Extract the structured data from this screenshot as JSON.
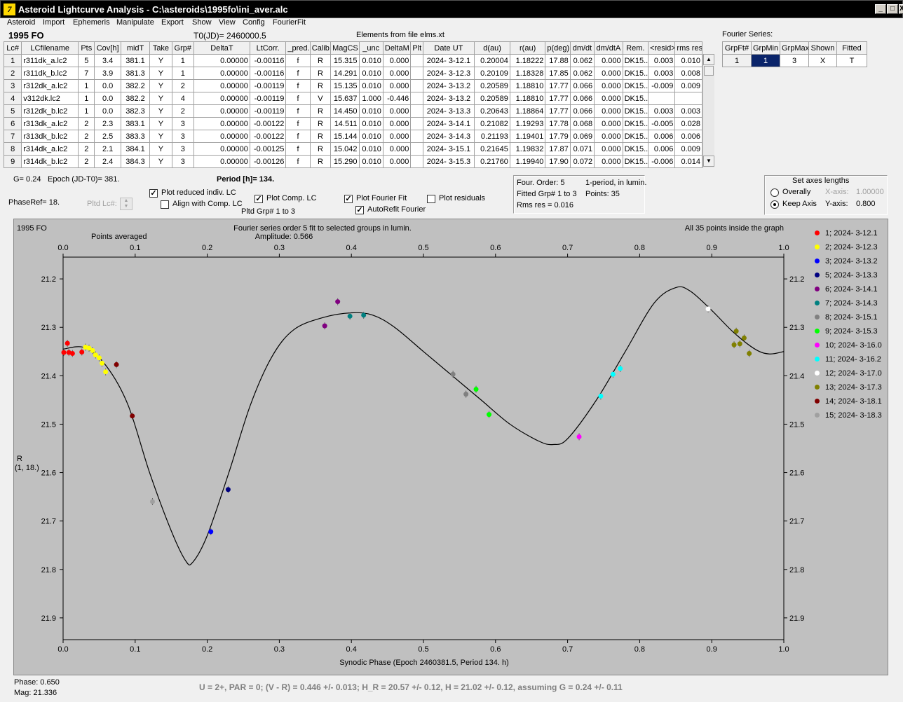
{
  "window": {
    "title": "Asteroid Lightcurve Analysis - C:\\asteroids\\1995fo\\ini_aver.alc",
    "min": "_",
    "max": "□",
    "close": "X"
  },
  "menu": [
    "Asteroid",
    "Import",
    "Ephemeris",
    "Manipulate",
    "Export",
    "Show",
    "View",
    "Config",
    "FourierFit"
  ],
  "header": {
    "object": "1995 FO",
    "t0": "T0(JD)= 2460000.5",
    "elements": "Elements from file elms.xt",
    "fourier_label": "Fourier Series:"
  },
  "table": {
    "columns": [
      "Lc#",
      "LCfilename",
      "Pts",
      "Cov[h]",
      "midT",
      "Take",
      "Grp#",
      "DeltaT",
      "LtCorr.",
      "_pred.",
      "Calib.",
      "MagCS",
      "_unc",
      "DeltaM",
      "Plt",
      "Date UT",
      "d(au)",
      "r(au)",
      "p(deg)",
      "dm/dt",
      "dm/dtA",
      "Rem.",
      "<resid>",
      "rms res"
    ],
    "rows": [
      [
        "1",
        "r311dk_a.lc2",
        "5",
        "3.4",
        "381.1",
        "Y",
        "1",
        "0.00000",
        "-0.00116",
        "f",
        "R",
        "15.315",
        "0.010",
        "0.000",
        "",
        "2024- 3-12.1",
        "0.20004",
        "1.18222",
        "17.88",
        "0.062",
        "0.000",
        "DK15..",
        "0.003",
        "0.010"
      ],
      [
        "2",
        "r311dk_b.lc2",
        "7",
        "3.9",
        "381.3",
        "Y",
        "1",
        "0.00000",
        "-0.00116",
        "f",
        "R",
        "14.291",
        "0.010",
        "0.000",
        "",
        "2024- 3-12.3",
        "0.20109",
        "1.18328",
        "17.85",
        "0.062",
        "0.000",
        "DK15..",
        "0.003",
        "0.008"
      ],
      [
        "3",
        "r312dk_a.lc2",
        "1",
        "0.0",
        "382.2",
        "Y",
        "2",
        "0.00000",
        "-0.00119",
        "f",
        "R",
        "15.135",
        "0.010",
        "0.000",
        "",
        "2024- 3-13.2",
        "0.20589",
        "1.18810",
        "17.77",
        "0.066",
        "0.000",
        "DK15..",
        "-0.009",
        "0.009"
      ],
      [
        "4",
        "v312dk.lc2",
        "1",
        "0.0",
        "382.2",
        "Y",
        "4",
        "0.00000",
        "-0.00119",
        "f",
        "V",
        "15.637",
        "1.000",
        "-0.446",
        "",
        "2024- 3-13.2",
        "0.20589",
        "1.18810",
        "17.77",
        "0.066",
        "0.000",
        "DK15..",
        "",
        ""
      ],
      [
        "5",
        "r312dk_b.lc2",
        "1",
        "0.0",
        "382.3",
        "Y",
        "2",
        "0.00000",
        "-0.00119",
        "f",
        "R",
        "14.450",
        "0.010",
        "0.000",
        "",
        "2024- 3-13.3",
        "0.20643",
        "1.18864",
        "17.77",
        "0.066",
        "0.000",
        "DK15..",
        "0.003",
        "0.003"
      ],
      [
        "6",
        "r313dk_a.lc2",
        "2",
        "2.3",
        "383.1",
        "Y",
        "3",
        "0.00000",
        "-0.00122",
        "f",
        "R",
        "14.511",
        "0.010",
        "0.000",
        "",
        "2024- 3-14.1",
        "0.21082",
        "1.19293",
        "17.78",
        "0.068",
        "0.000",
        "DK15..",
        "-0.005",
        "0.028"
      ],
      [
        "7",
        "r313dk_b.lc2",
        "2",
        "2.5",
        "383.3",
        "Y",
        "3",
        "0.00000",
        "-0.00122",
        "f",
        "R",
        "15.144",
        "0.010",
        "0.000",
        "",
        "2024- 3-14.3",
        "0.21193",
        "1.19401",
        "17.79",
        "0.069",
        "0.000",
        "DK15..",
        "0.006",
        "0.006"
      ],
      [
        "8",
        "r314dk_a.lc2",
        "2",
        "2.1",
        "384.1",
        "Y",
        "3",
        "0.00000",
        "-0.00125",
        "f",
        "R",
        "15.042",
        "0.010",
        "0.000",
        "",
        "2024- 3-15.1",
        "0.21645",
        "1.19832",
        "17.87",
        "0.071",
        "0.000",
        "DK15..",
        "0.006",
        "0.009"
      ],
      [
        "9",
        "r314dk_b.lc2",
        "2",
        "2.4",
        "384.3",
        "Y",
        "3",
        "0.00000",
        "-0.00126",
        "f",
        "R",
        "15.290",
        "0.010",
        "0.000",
        "",
        "2024- 3-15.3",
        "0.21760",
        "1.19940",
        "17.90",
        "0.072",
        "0.000",
        "DK15..",
        "-0.006",
        "0.014"
      ]
    ]
  },
  "fourier_table": {
    "columns": [
      "GrpFt#",
      "GrpMin",
      "GrpMax",
      "Shown",
      "Fitted"
    ],
    "row": [
      "1",
      "1",
      "3",
      "X",
      "T"
    ]
  },
  "info": {
    "g": "G= 0.24",
    "epoch": "Epoch (JD-T0)= 381.",
    "period": "Period [h]= 134.",
    "phaseref": "PhaseRef= 18.",
    "pltd_lc": "Pltd Lc#:",
    "pltd_grp": "Pltd Grp#  1   to   3"
  },
  "checks": {
    "plot_reduced": "Plot reduced indiv. LC",
    "align": "Align with Comp. LC",
    "plot_comp": "Plot Comp. LC",
    "plot_fourier": "Plot Fourier Fit",
    "autorefit": "AutoRefit Fourier",
    "plot_resid": "Plot residuals"
  },
  "fourier_info": {
    "order": "Four. Order:  5",
    "period_mode": "1-period, in lumin.",
    "fitted": "Fitted Grp# 1 to 3",
    "points": "Points: 35",
    "rms": "Rms res     = 0.016"
  },
  "axes_panel": {
    "title": "Set axes lengths",
    "overally": "Overally",
    "keep": "Keep Axis",
    "xaxis_label": "X-axis:",
    "xaxis_val": "1.00000",
    "yaxis_label": "Y-axis:",
    "yaxis_val": "0.800"
  },
  "status": {
    "phase": "Phase:  0.650",
    "mag": "Mag:    21.336",
    "formula": "U = 2+, PAR = 0; (V - R) = 0.446 +/- 0.013; H_R = 20.57 +/- 0.12, H = 21.02 +/- 0.12, assuming G = 0.24 +/- 0.11"
  },
  "chart_data": {
    "type": "scatter",
    "title": "1995 FO",
    "subtitle": "Fourier series order 5 fit to selected groups in lumin.",
    "subtitle2": "Amplitude: 0.566",
    "note_left": "Points averaged",
    "note_right": "All 35 points inside the graph",
    "xlabel": "Synodic Phase (Epoch 2460381.5, Period 134. h)",
    "ylabel": "R",
    "ylabel2": "(1, 18.)",
    "xlim": [
      0,
      1
    ],
    "ylim": [
      21.9,
      21.1
    ],
    "xticks": [
      "0.0",
      "0.1",
      "0.2",
      "0.3",
      "0.4",
      "0.5",
      "0.6",
      "0.7",
      "0.8",
      "0.9",
      "1.0"
    ],
    "yticks": [
      "21.2",
      "21.3",
      "21.4",
      "21.5",
      "21.6",
      "21.7",
      "21.8",
      "21.9"
    ],
    "series": [
      {
        "name": "1; 2024- 3-12.1",
        "color": "#ff0000",
        "points": [
          [
            0.001,
            21.352
          ],
          [
            0.006,
            21.333
          ],
          [
            0.008,
            21.352
          ],
          [
            0.013,
            21.354
          ],
          [
            0.026,
            21.351
          ]
        ]
      },
      {
        "name": "2; 2024- 3-12.3",
        "color": "#ffff00",
        "points": [
          [
            0.031,
            21.341
          ],
          [
            0.036,
            21.343
          ],
          [
            0.041,
            21.348
          ],
          [
            0.045,
            21.357
          ],
          [
            0.05,
            21.363
          ],
          [
            0.054,
            21.374
          ],
          [
            0.059,
            21.392
          ]
        ]
      },
      {
        "name": "3; 2024- 3-13.2",
        "color": "#0000ff",
        "points": [
          [
            0.205,
            21.722
          ]
        ]
      },
      {
        "name": "5; 2024- 3-13.3",
        "color": "#000080",
        "points": [
          [
            0.229,
            21.635
          ]
        ]
      },
      {
        "name": "6; 2024- 3-14.1",
        "color": "#800080",
        "points": [
          [
            0.363,
            21.297
          ],
          [
            0.381,
            21.247
          ]
        ]
      },
      {
        "name": "7; 2024- 3-14.3",
        "color": "#008080",
        "points": [
          [
            0.398,
            21.277
          ],
          [
            0.417,
            21.275
          ]
        ]
      },
      {
        "name": "8; 2024- 3-15.1",
        "color": "#808080",
        "points": [
          [
            0.541,
            21.397
          ],
          [
            0.559,
            21.438
          ]
        ]
      },
      {
        "name": "9; 2024- 3-15.3",
        "color": "#00ff00",
        "points": [
          [
            0.573,
            21.428
          ],
          [
            0.591,
            21.48
          ]
        ]
      },
      {
        "name": "10; 2024- 3-16.0",
        "color": "#ff00ff",
        "points": [
          [
            0.716,
            21.526
          ]
        ]
      },
      {
        "name": "11; 2024- 3-16.2",
        "color": "#00ffff",
        "points": [
          [
            0.746,
            21.442
          ],
          [
            0.763,
            21.397
          ],
          [
            0.773,
            21.385
          ]
        ]
      },
      {
        "name": "12; 2024- 3-17.0",
        "color": "#ffffff",
        "points": [
          [
            0.895,
            21.262
          ]
        ]
      },
      {
        "name": "13; 2024- 3-17.3",
        "color": "#808000",
        "points": [
          [
            0.931,
            21.336
          ],
          [
            0.934,
            21.308
          ],
          [
            0.939,
            21.334
          ],
          [
            0.945,
            21.322
          ],
          [
            0.952,
            21.354
          ]
        ]
      },
      {
        "name": "14; 2024- 3-18.1",
        "color": "#800000",
        "points": [
          [
            0.074,
            21.377
          ],
          [
            0.096,
            21.483
          ]
        ]
      },
      {
        "name": "15; 2024- 3-18.3",
        "color": "#a0a0a0",
        "points": [
          [
            0.124,
            21.66
          ]
        ]
      }
    ],
    "fit_curve": [
      [
        0.0,
        21.345
      ],
      [
        0.03,
        21.342
      ],
      [
        0.06,
        21.38
      ],
      [
        0.09,
        21.46
      ],
      [
        0.12,
        21.6
      ],
      [
        0.15,
        21.72
      ],
      [
        0.17,
        21.782
      ],
      [
        0.18,
        21.785
      ],
      [
        0.2,
        21.73
      ],
      [
        0.23,
        21.6
      ],
      [
        0.26,
        21.46
      ],
      [
        0.29,
        21.36
      ],
      [
        0.32,
        21.305
      ],
      [
        0.36,
        21.28
      ],
      [
        0.4,
        21.27
      ],
      [
        0.43,
        21.275
      ],
      [
        0.46,
        21.3
      ],
      [
        0.5,
        21.35
      ],
      [
        0.54,
        21.4
      ],
      [
        0.58,
        21.45
      ],
      [
        0.62,
        21.5
      ],
      [
        0.66,
        21.535
      ],
      [
        0.68,
        21.542
      ],
      [
        0.7,
        21.53
      ],
      [
        0.74,
        21.45
      ],
      [
        0.78,
        21.35
      ],
      [
        0.82,
        21.25
      ],
      [
        0.85,
        21.218
      ],
      [
        0.87,
        21.225
      ],
      [
        0.9,
        21.265
      ],
      [
        0.93,
        21.31
      ],
      [
        0.96,
        21.345
      ],
      [
        0.98,
        21.355
      ],
      [
        1.0,
        21.35
      ]
    ]
  }
}
